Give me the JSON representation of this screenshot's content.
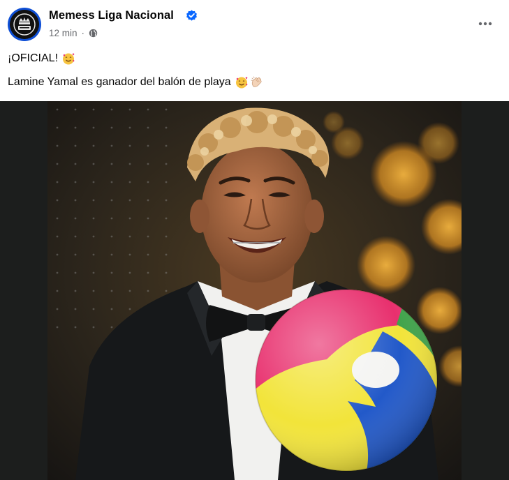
{
  "post": {
    "page_name": "Memess Liga Nacional",
    "time": "12 min",
    "separator": "·",
    "audience_icon": "globe-icon",
    "verified_icon": "verified-badge-icon",
    "more_icon": "more-options-icon",
    "lines": [
      {
        "text": "¡OFICIAL!",
        "emojis": [
          "smiling-face-with-hearts-emoji"
        ]
      },
      {
        "text": "Lamine Yamal es ganador del balón de playa",
        "emojis": [
          "smiling-face-with-hearts-emoji",
          "clapping-hands-emoji"
        ]
      }
    ],
    "image": {
      "description_icon": "photo-beach-ball-award",
      "colors": {
        "ball_red": "#e8306e",
        "ball_yellow": "#f2e43a",
        "ball_blue": "#2259c9",
        "ball_green": "#3fa34a"
      }
    }
  },
  "colors": {
    "brand_blue": "#0866ff",
    "meta_gray": "#65676b",
    "text": "#050505"
  }
}
